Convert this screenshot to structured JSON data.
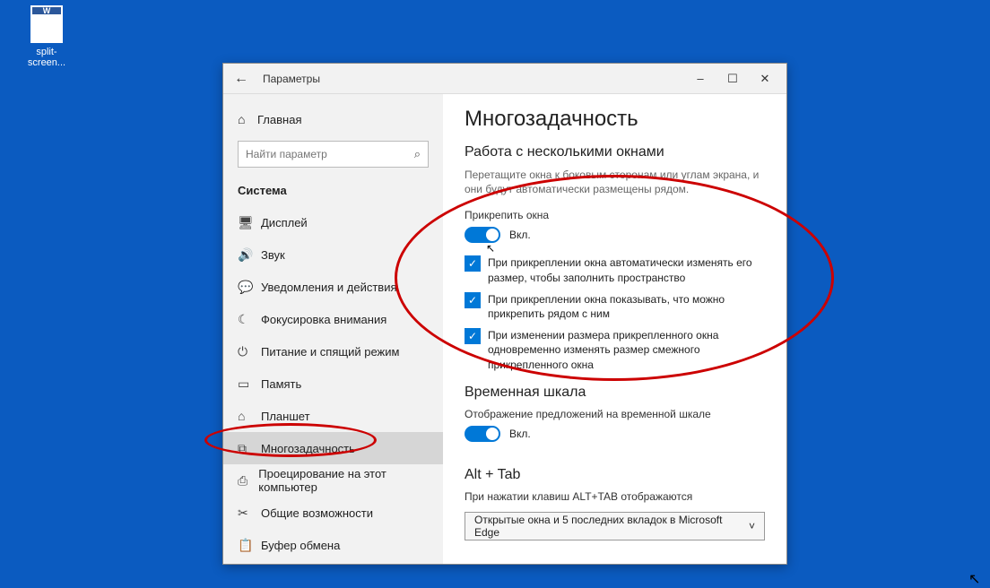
{
  "desktop": {
    "file_label": "split-screen..."
  },
  "window": {
    "title": "Параметры",
    "controls": {
      "min": "–",
      "max": "☐",
      "close": "✕"
    }
  },
  "sidebar": {
    "home": "Главная",
    "search_placeholder": "Найти параметр",
    "section": "Система",
    "items": [
      {
        "icon": "🖥",
        "label": "Дисплей"
      },
      {
        "icon": "🔊",
        "label": "Звук"
      },
      {
        "icon": "💬",
        "label": "Уведомления и действия"
      },
      {
        "icon": "☾",
        "label": "Фокусировка внимания"
      },
      {
        "icon": "⏻",
        "label": "Питание и спящий режим"
      },
      {
        "icon": "▭",
        "label": "Память"
      },
      {
        "icon": "⌂",
        "label": "Планшет"
      },
      {
        "icon": "⧉",
        "label": "Многозадачность"
      },
      {
        "icon": "⎙",
        "label": "Проецирование на этот компьютер"
      },
      {
        "icon": "✂",
        "label": "Общие возможности"
      },
      {
        "icon": "📋",
        "label": "Буфер обмена"
      }
    ]
  },
  "main": {
    "heading": "Многозадачность",
    "sec1_title": "Работа с несколькими окнами",
    "sec1_desc": "Перетащите окна к боковым сторонам или углам экрана, и они будут автоматически размещены рядом.",
    "snap_label": "Прикрепить окна",
    "on_label": "Вкл.",
    "checks": [
      "При прикреплении окна автоматически изменять его размер, чтобы заполнить пространство",
      "При прикреплении окна показывать, что можно прикрепить рядом с ним",
      "При изменении размера прикрепленного окна одновременно изменять размер смежного прикрепленного окна"
    ],
    "sec2_title": "Временная шкала",
    "sec2_label": "Отображение предложений на временной шкале",
    "sec3_title": "Alt + Tab",
    "sec3_label": "При нажатии клавиш ALT+TAB отображаются",
    "dropdown_value": "Открытые окна и 5 последних вкладок в Microsoft Edge"
  }
}
